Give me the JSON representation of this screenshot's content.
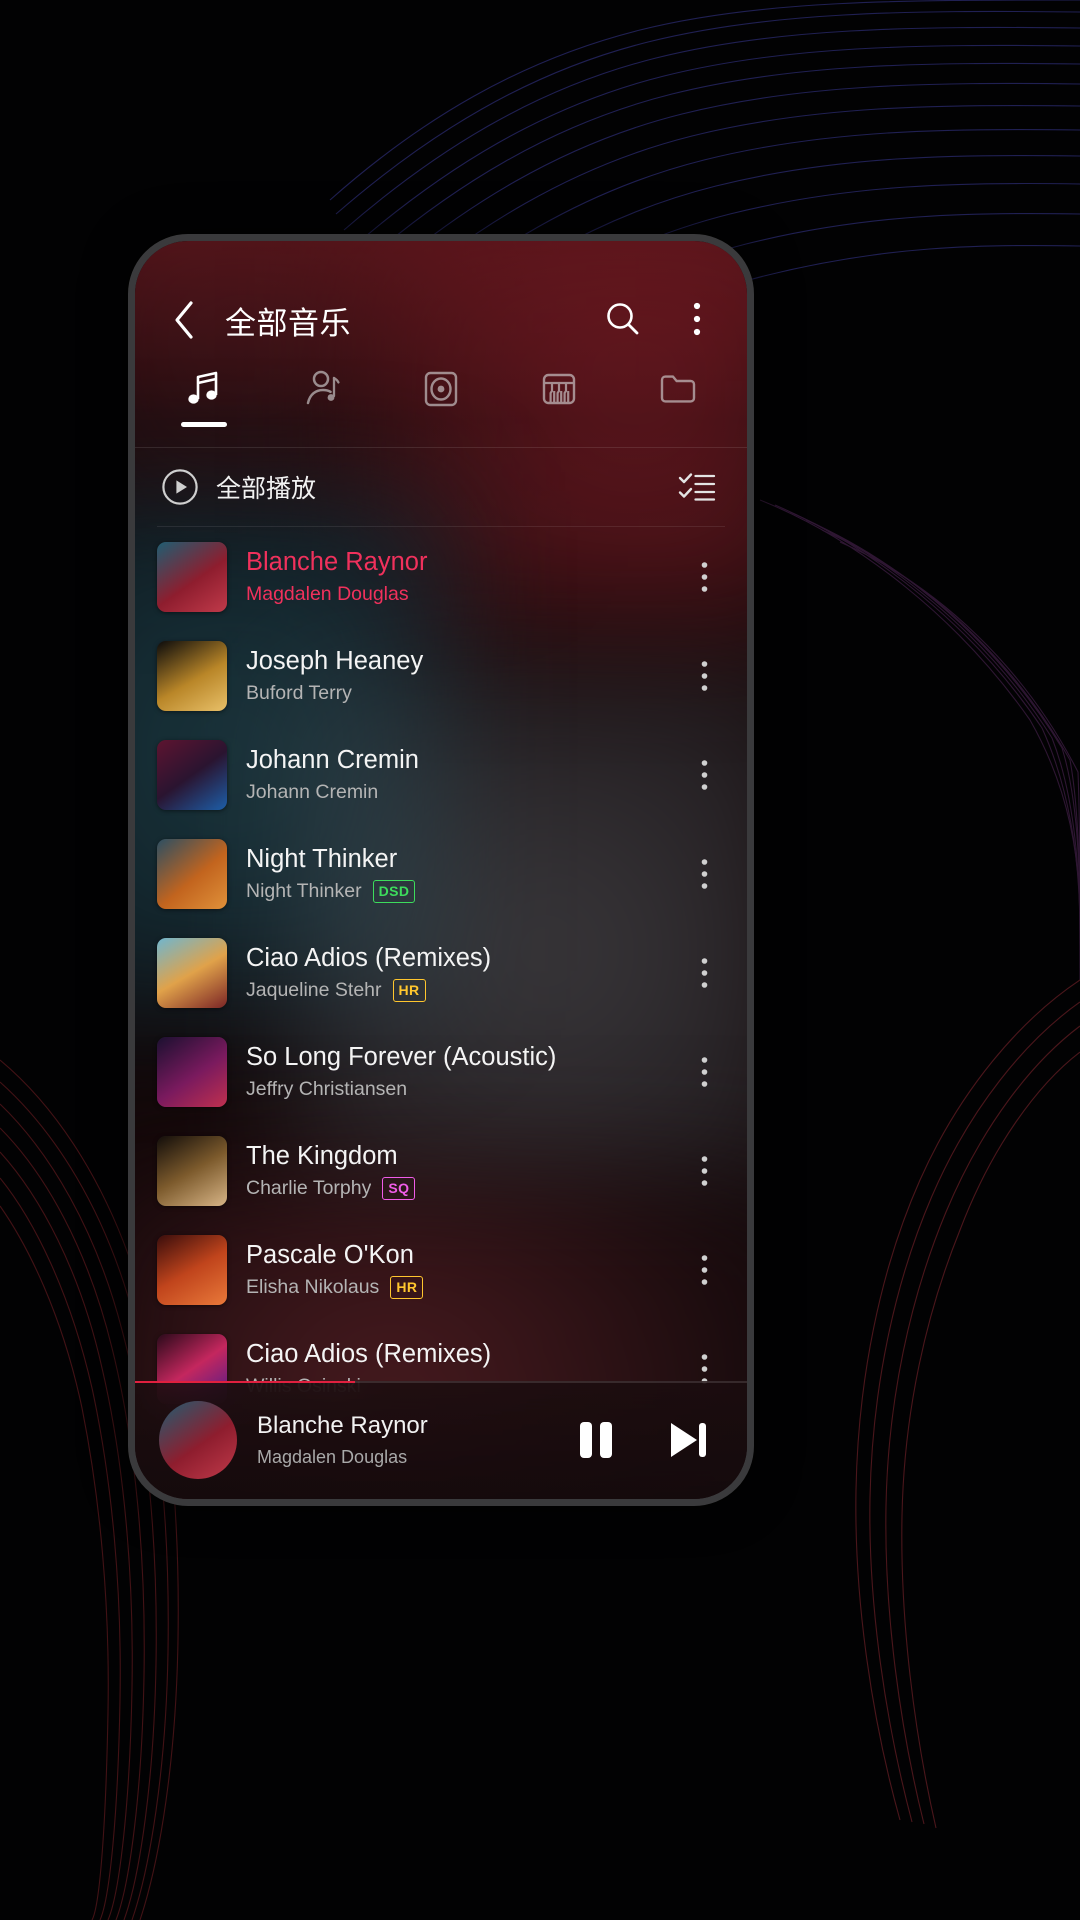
{
  "app": {
    "header": {
      "back_icon": "chevron-left-icon",
      "title": "全部音乐",
      "search_icon": "search-icon",
      "overflow_icon": "more-vertical-icon"
    },
    "tabs": [
      {
        "key": "songs",
        "icon": "music-note-icon",
        "active": true
      },
      {
        "key": "artists",
        "icon": "artist-icon",
        "active": false
      },
      {
        "key": "albums",
        "icon": "album-disc-icon",
        "active": false
      },
      {
        "key": "genres",
        "icon": "piano-keys-icon",
        "active": false
      },
      {
        "key": "folders",
        "icon": "folder-icon",
        "active": false
      }
    ],
    "playall": {
      "icon": "play-circle-icon",
      "label": "全部播放",
      "multiselect_icon": "checklist-icon"
    },
    "songs": [
      {
        "title": "Blanche Raynor",
        "artist": "Magdalen Douglas",
        "badge": "",
        "playing": true
      },
      {
        "title": "Joseph Heaney",
        "artist": "Buford Terry",
        "badge": "",
        "playing": false
      },
      {
        "title": "Johann Cremin",
        "artist": "Johann Cremin",
        "badge": "",
        "playing": false
      },
      {
        "title": "Night Thinker",
        "artist": "Night Thinker",
        "badge": "DSD",
        "playing": false
      },
      {
        "title": "Ciao Adios (Remixes)",
        "artist": "Jaqueline Stehr",
        "badge": "HR",
        "playing": false
      },
      {
        "title": "So Long Forever (Acoustic)",
        "artist": "Jeffry Christiansen",
        "badge": "",
        "playing": false
      },
      {
        "title": "The Kingdom",
        "artist": "Charlie Torphy",
        "badge": "SQ",
        "playing": false
      },
      {
        "title": "Pascale O'Kon",
        "artist": "Elisha Nikolaus",
        "badge": "HR",
        "playing": false
      },
      {
        "title": "Ciao Adios (Remixes)",
        "artist": "Willis Osinski",
        "badge": "",
        "playing": false
      }
    ],
    "row_more_icon": "more-vertical-icon",
    "miniplayer": {
      "title": "Blanche Raynor",
      "artist": "Magdalen Douglas",
      "pause_icon": "pause-icon",
      "next_icon": "skip-next-icon",
      "progress_percent": 36
    },
    "colors": {
      "accent_playing": "#f0315c",
      "badge_dsd": "#3ddc5c",
      "badge_hr": "#ffc62e",
      "badge_sq": "#f05ce8",
      "progress": "#e0203f",
      "text_primary": "#f4f4f4",
      "text_secondary": "#b4b4b4"
    }
  }
}
